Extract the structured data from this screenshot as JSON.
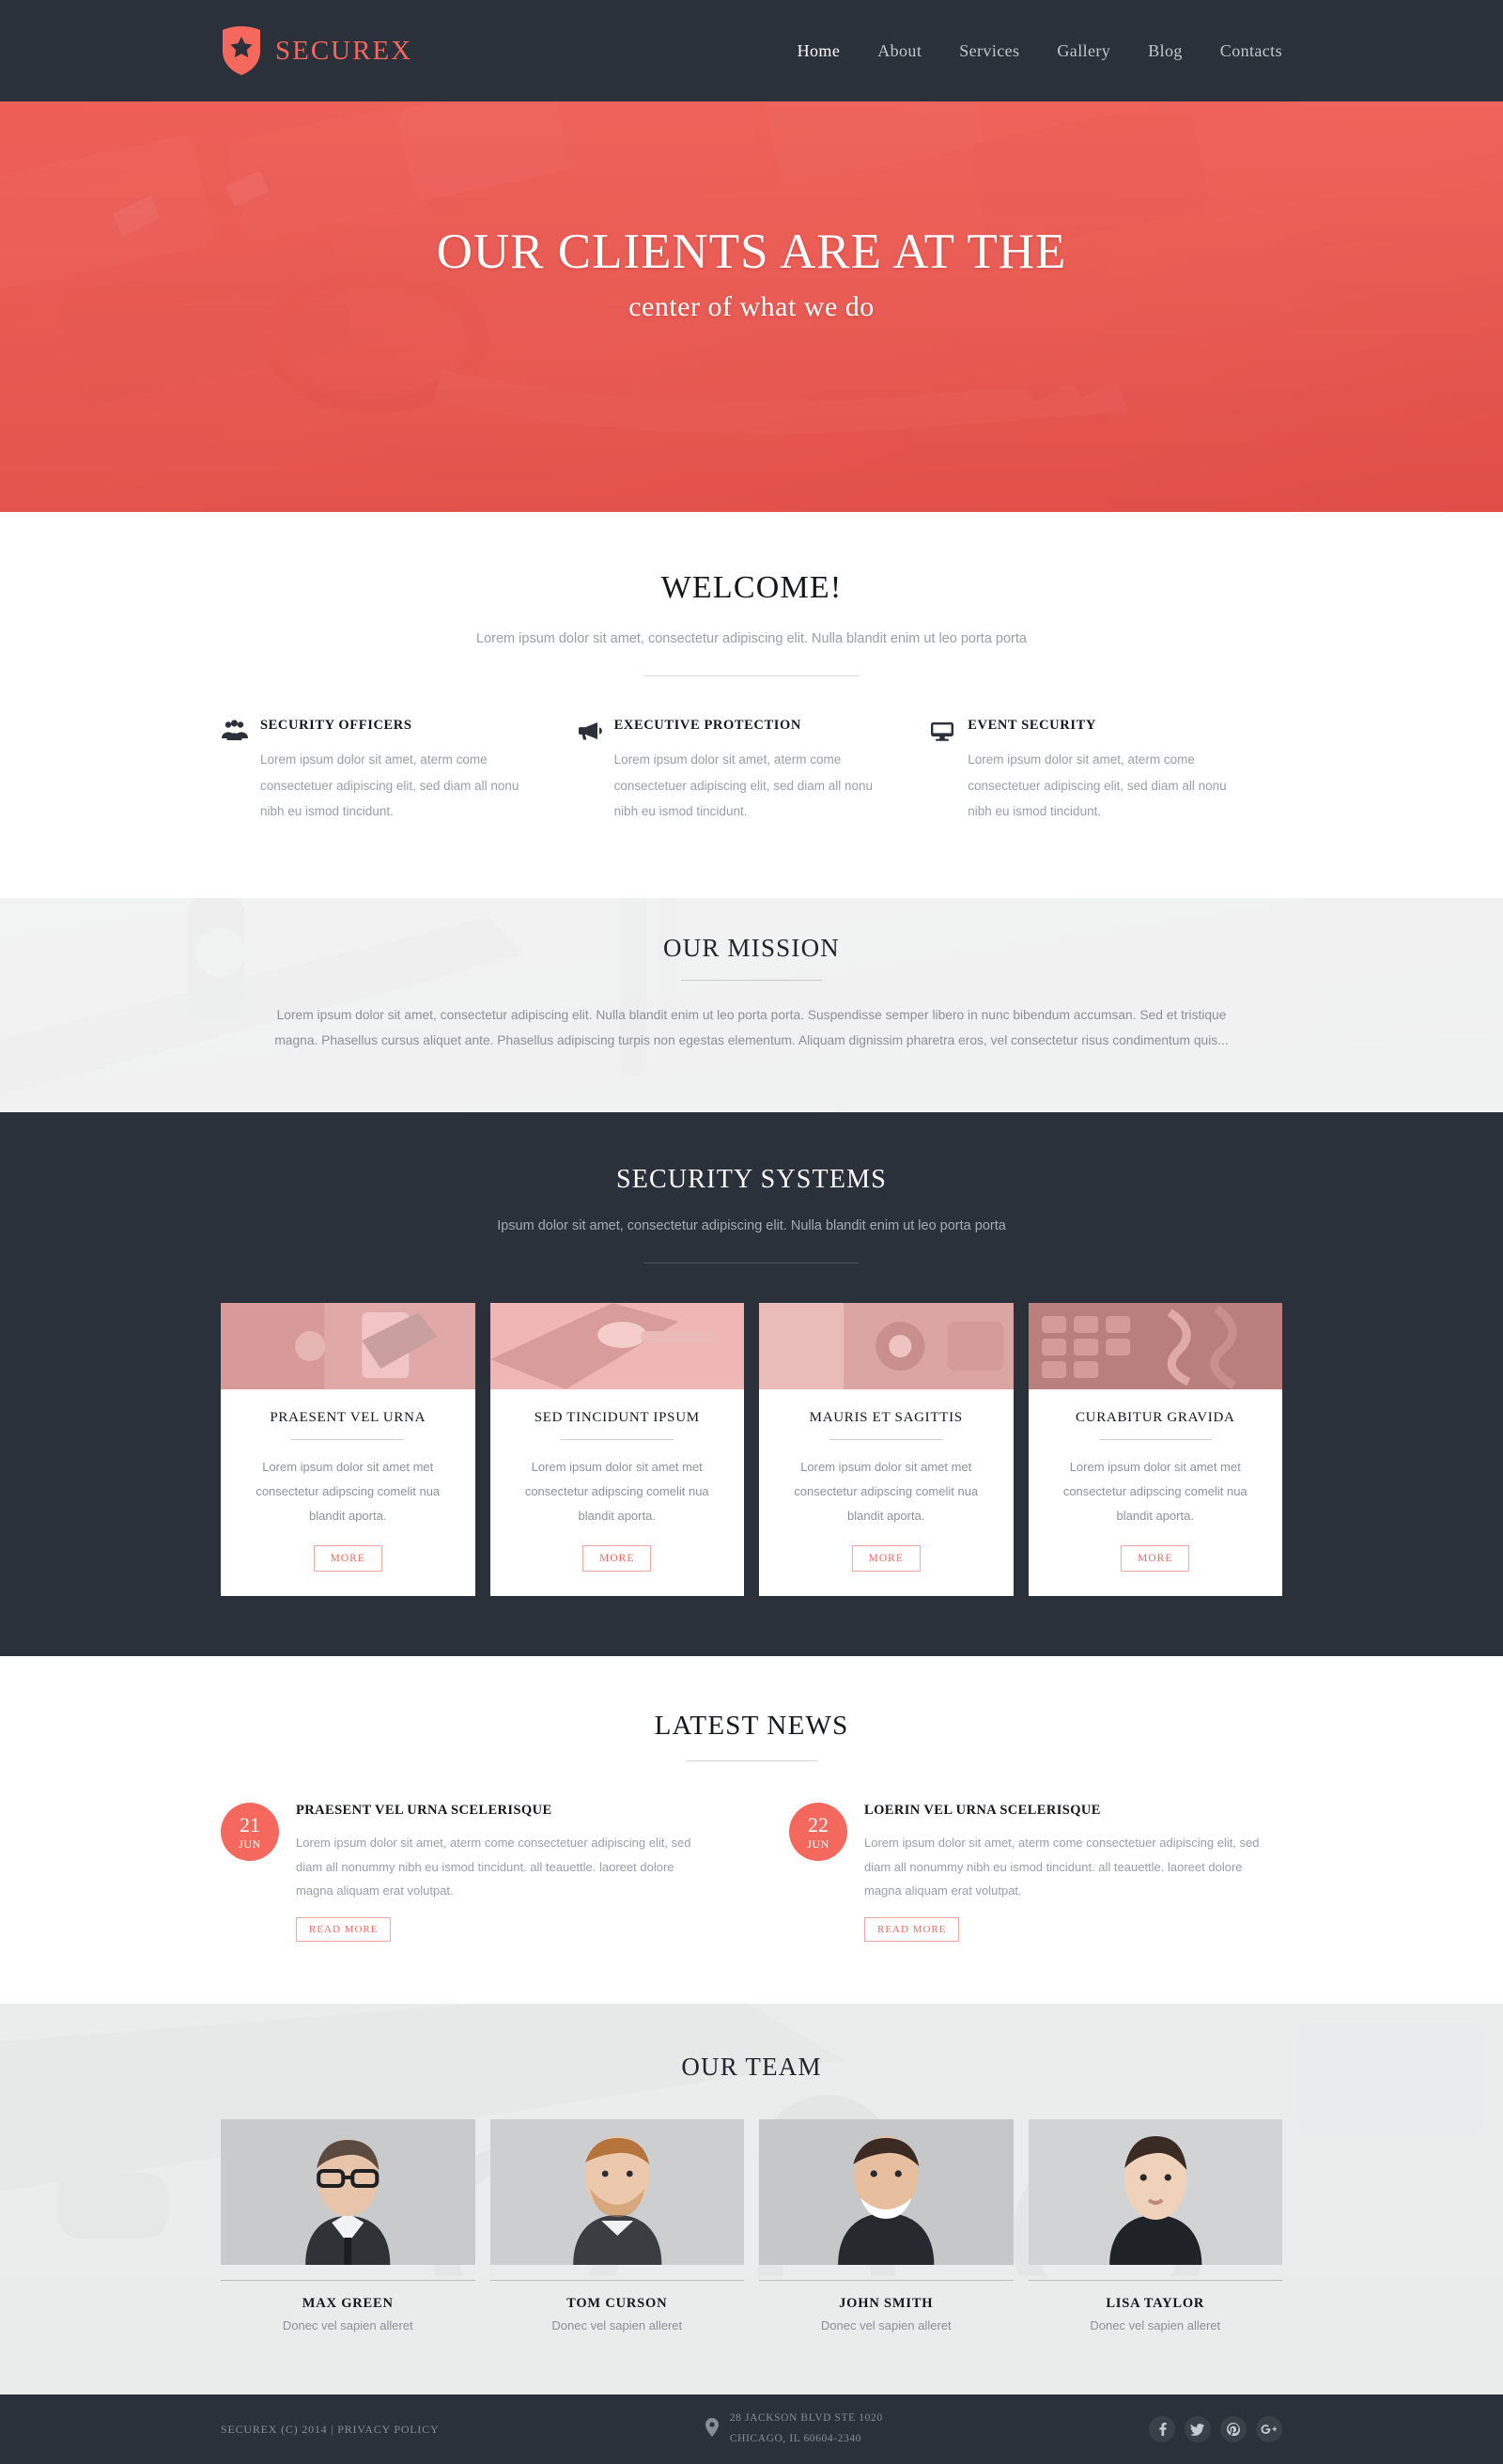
{
  "brand": {
    "name": "SECUREX",
    "accent": "#f5685e",
    "dark": "#2b313a"
  },
  "nav": {
    "items": [
      {
        "label": "Home",
        "active": true
      },
      {
        "label": "About",
        "active": false
      },
      {
        "label": "Services",
        "active": false
      },
      {
        "label": "Gallery",
        "active": false
      },
      {
        "label": "Blog",
        "active": false
      },
      {
        "label": "Contacts",
        "active": false
      }
    ]
  },
  "hero": {
    "title": "OUR CLIENTS ARE AT THE",
    "subtitle": "center of what we do"
  },
  "welcome": {
    "title": "WELCOME!",
    "lead": "Lorem ipsum dolor sit amet, consectetur adipiscing elit. Nulla blandit enim ut leo porta porta",
    "features": [
      {
        "icon": "users-icon",
        "title": "SECURITY OFFICERS",
        "text": "Lorem ipsum dolor sit amet, aterm come consectetuer adipiscing elit, sed diam all nonu nibh eu ismod  tincidunt."
      },
      {
        "icon": "megaphone-icon",
        "title": "EXECUTIVE PROTECTION",
        "text": "Lorem ipsum dolor sit amet, aterm come consectetuer adipiscing elit, sed diam all nonu nibh eu ismod  tincidunt."
      },
      {
        "icon": "monitor-icon",
        "title": "EVENT SECURITY",
        "text": "Lorem ipsum dolor sit amet, aterm come consectetuer adipiscing elit, sed diam all nonu nibh eu ismod  tincidunt."
      }
    ]
  },
  "mission": {
    "title": "OUR MISSION",
    "text": "Lorem ipsum dolor sit amet, consectetur adipiscing elit. Nulla blandit enim ut leo porta porta. Suspendisse semper libero in nunc bibendum accumsan. Sed et tristique magna. Phasellus cursus aliquet ante. Phasellus adipiscing turpis non egestas elementum. Aliquam dignissim pharetra eros, vel consectetur risus condimentum quis..."
  },
  "systems": {
    "title": "SECURITY SYSTEMS",
    "lead": "Ipsum dolor sit amet, consectetur adipiscing elit. Nulla blandit enim ut leo porta porta",
    "cards": [
      {
        "title": "PRAESENT VEL URNA",
        "text": "Lorem ipsum dolor sit amet met consectetur adipscing  comelit nua blandit aporta.",
        "button": "MORE"
      },
      {
        "title": "SED TINCIDUNT IPSUM",
        "text": "Lorem ipsum dolor sit amet met consectetur adipscing  comelit nua blandit aporta.",
        "button": "MORE"
      },
      {
        "title": "MAURIS ET SAGITTIS",
        "text": "Lorem ipsum dolor sit amet met consectetur adipscing  comelit nua blandit aporta.",
        "button": "MORE"
      },
      {
        "title": "CURABITUR GRAVIDA",
        "text": "Lorem ipsum dolor sit amet met consectetur adipscing  comelit nua blandit aporta.",
        "button": "MORE"
      }
    ]
  },
  "news": {
    "title": "LATEST NEWS",
    "items": [
      {
        "day": "21",
        "month": "JUN",
        "title": "PRAESENT VEL URNA SCELERISQUE",
        "text": "Lorem ipsum dolor sit amet, aterm come consectetuer adipiscing elit, sed diam all nonummy nibh eu ismod  tincidunt. all teauettle. laoreet dolore magna aliquam erat volutpat.",
        "button": "READ MORE"
      },
      {
        "day": "22",
        "month": "JUN",
        "title": "LOERIN  VEL URNA SCELERISQUE",
        "text": "Lorem ipsum dolor sit amet, aterm come consectetuer adipiscing elit, sed diam all nonummy nibh eu ismod  tincidunt. all teauettle. laoreet dolore magna aliquam erat volutpat.",
        "button": "READ MORE"
      }
    ]
  },
  "team": {
    "title": "OUR TEAM",
    "members": [
      {
        "name": "MAX GREEN",
        "role": "Donec vel sapien alleret"
      },
      {
        "name": "TOM CURSON",
        "role": "Donec vel sapien alleret"
      },
      {
        "name": "JOHN SMITH",
        "role": "Donec vel sapien alleret"
      },
      {
        "name": "LISA TAYLOR",
        "role": "Donec vel sapien alleret"
      }
    ]
  },
  "footer": {
    "copyright": "SECUREX (C) 2014  |  PRIVACY POLICY",
    "address_line1": "28 JACKSON BLVD STE 1020",
    "address_line2": "CHICAGO, IL 60604-2340",
    "socials": [
      {
        "name": "facebook-icon",
        "glyph": "f"
      },
      {
        "name": "twitter-icon",
        "glyph": "ᴠ"
      },
      {
        "name": "pinterest-icon",
        "glyph": "Ⓟ"
      },
      {
        "name": "googleplus-icon",
        "glyph": "g+"
      }
    ]
  }
}
